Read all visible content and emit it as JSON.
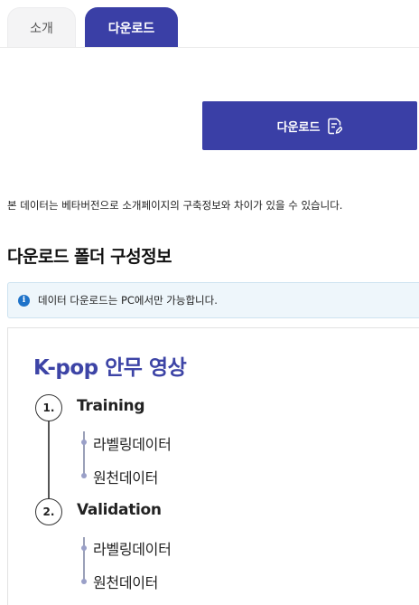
{
  "tabs": [
    {
      "label": "소개",
      "active": false
    },
    {
      "label": "다운로드",
      "active": true
    }
  ],
  "download_button": {
    "label": "다운로드",
    "icon": "document-edit-icon"
  },
  "notice": "본 데이터는 베타버전으로 소개페이지의 구축정보와 차이가 있을 수 있습니다.",
  "section_title": "다운로드 폴더 구성정보",
  "info": {
    "icon": "info-icon",
    "text": "데이터 다운로드는 PC에서만 가능합니다."
  },
  "folder": {
    "title": "K-pop 안무 영상",
    "groups": [
      {
        "number": "1.",
        "name": "Training",
        "items": [
          "라벨링데이터",
          "원천데이터"
        ]
      },
      {
        "number": "2.",
        "name": "Validation",
        "items": [
          "라벨링데이터",
          "원천데이터"
        ]
      }
    ]
  },
  "colors": {
    "primary": "#3a3fa6",
    "info_bg": "#eef6fb",
    "info_icon": "#1f73c9"
  }
}
